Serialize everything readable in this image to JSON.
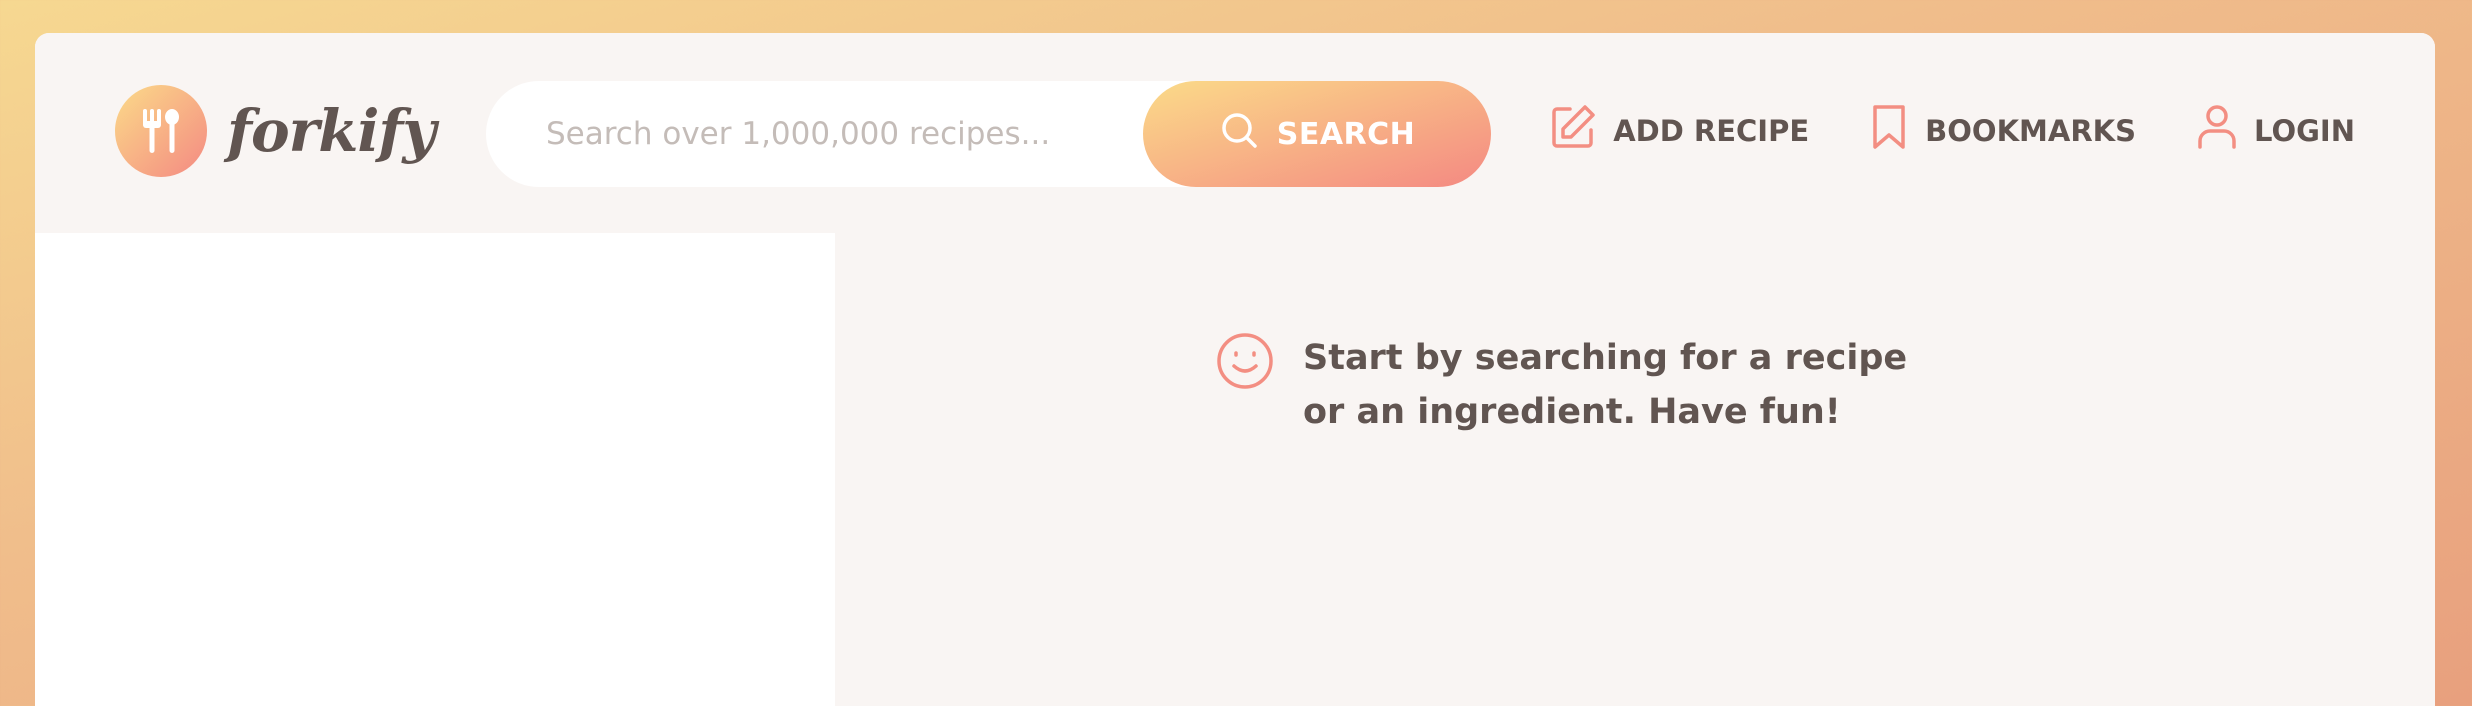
{
  "app": {
    "logo_text": "forkify"
  },
  "search": {
    "placeholder": "Search over 1,000,000 recipes...",
    "button_label": "SEARCH"
  },
  "nav": {
    "add_recipe": "ADD RECIPE",
    "bookmarks": "BOOKMARKS",
    "login": "LOGIN"
  },
  "recipe": {
    "message": "Start by searching for a recipe or an ingredient. Have fun!"
  },
  "icons": {
    "logo": "fork-spoon-icon",
    "search": "search-icon",
    "add_recipe": "edit-icon",
    "bookmarks": "bookmark-icon",
    "login": "user-icon",
    "message": "smile-icon"
  },
  "colors": {
    "accent": "#f38e82",
    "gradient_start": "#fbdb89",
    "gradient_end": "#f48982",
    "text": "#615551",
    "background": "#f9f5f3"
  }
}
